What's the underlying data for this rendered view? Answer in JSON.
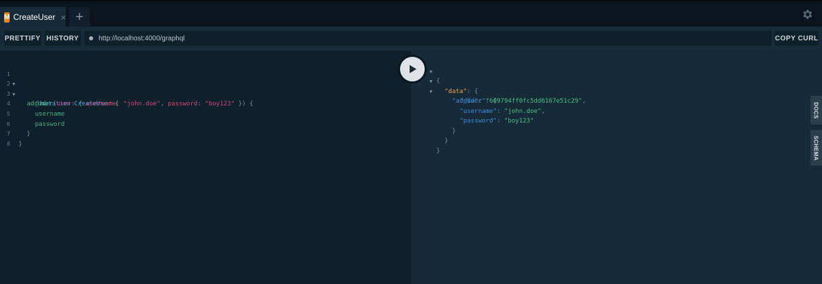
{
  "tabs": [
    {
      "badge": "M",
      "title": "CreateUser",
      "close": "×"
    }
  ],
  "add_tab_label": "+",
  "settings_icon": "gear-icon",
  "toolbar": {
    "prettify_label": "PRETTIFY",
    "history_label": "HISTORY",
    "endpoint": "http://localhost:4000/graphql",
    "copy_curl_label": "COPY CURL"
  },
  "query": {
    "line_numbers": [
      "1",
      "2",
      "3",
      "4",
      "5",
      "6",
      "7",
      "8"
    ],
    "lines": {
      "l1_kw": "mutation",
      "l1_name": "CreateUser",
      "l1_brace": "{",
      "l2_fn": "addUser",
      "l2_p1": "(",
      "l2_arg": "user",
      "l2_p2": ": { ",
      "l2_k1": "username",
      "l2_p3": ": ",
      "l2_v1": "\"john.doe\"",
      "l2_p4": ", ",
      "l2_k2": "password",
      "l2_p5": ": ",
      "l2_v2": "\"boy123\"",
      "l2_p6": " }) {",
      "l3": "_id",
      "l4": "username",
      "l5": "password",
      "l6": "}",
      "l7": "}"
    }
  },
  "result": {
    "open_brace": "{",
    "data_key": "\"data\"",
    "data_colon": ": {",
    "adduser_key": "\"addUser\"",
    "adduser_colon": ": {",
    "id_key": "\"_id\"",
    "id_colon": ": ",
    "id_value": "\"609794ff0fc5dd6167e51c29\"",
    "id_comma": ",",
    "username_key": "\"username\"",
    "username_colon": ": ",
    "username_value": "\"john.doe\"",
    "username_comma": ",",
    "password_key": "\"password\"",
    "password_colon": ": ",
    "password_value": "\"boy123\"",
    "close3": "}",
    "close2": "}",
    "close1": "}"
  },
  "side_tabs": {
    "docs": "DOCS",
    "schema": "SCHEMA"
  }
}
